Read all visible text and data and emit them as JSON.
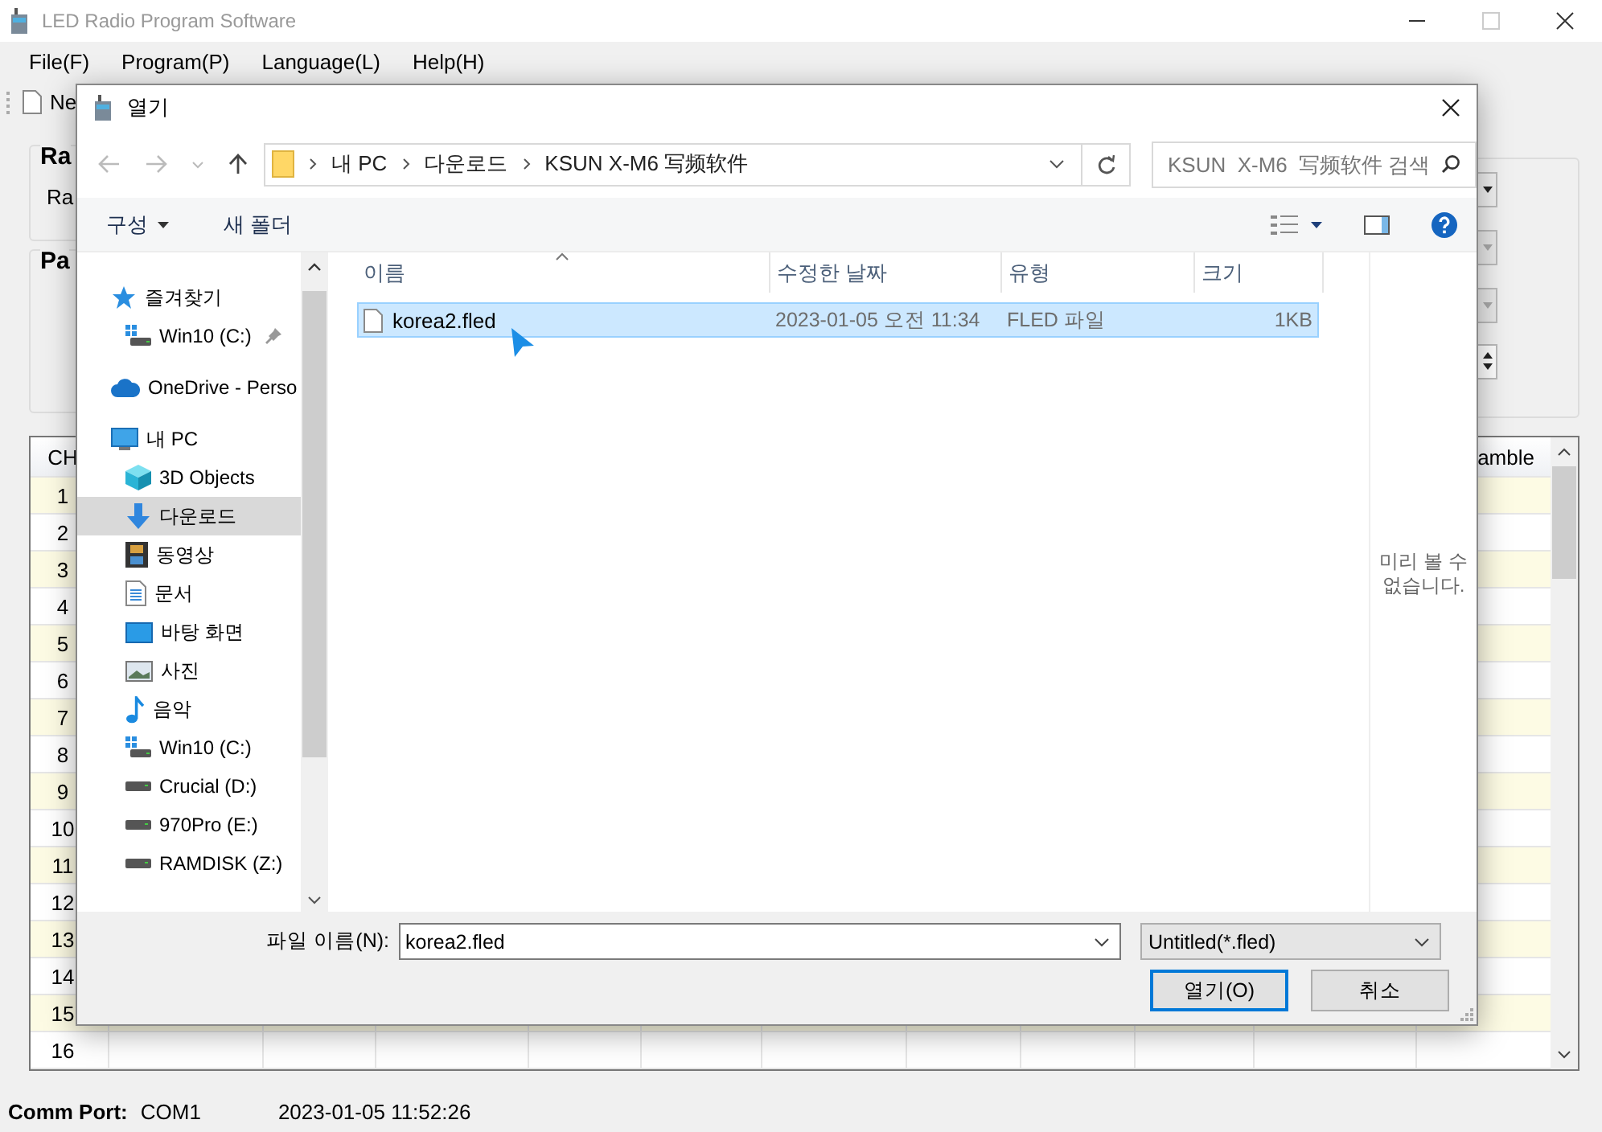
{
  "app": {
    "title": "LED Radio Program Software",
    "menu": [
      "File(F)",
      "Program(P)",
      "Language(L)",
      "Help(H)"
    ],
    "toolbar_label": "Ne",
    "groups": [
      {
        "label": "Ra",
        "field_label": "Ra"
      },
      {
        "label": "Pa"
      }
    ],
    "table": {
      "columns": [
        {
          "label": "CH"
        },
        {
          "label": "amble"
        }
      ],
      "rows": [
        {
          "ch": "1"
        },
        {
          "ch": "2"
        },
        {
          "ch": "3"
        },
        {
          "ch": "4"
        },
        {
          "ch": "5"
        },
        {
          "ch": "6"
        },
        {
          "ch": "7"
        },
        {
          "ch": "8"
        },
        {
          "ch": "9"
        },
        {
          "ch": "10"
        },
        {
          "ch": "11"
        },
        {
          "ch": "12"
        },
        {
          "ch": "13"
        },
        {
          "ch": "14"
        },
        {
          "ch": "15"
        },
        {
          "ch": "16"
        }
      ]
    },
    "status_bar": {
      "port_label": "Comm Port:",
      "port": "COM1",
      "time": "2023-01-05 11:52:26"
    }
  },
  "dialog": {
    "title": "열기",
    "breadcrumbs": [
      "내 PC",
      "다운로드",
      "KSUN  X-M6  写频软件"
    ],
    "search": {
      "placeholder": "KSUN  X-M6  写频软件 검색"
    },
    "toolbar": [
      "구성",
      "새 폴더"
    ],
    "nav": [
      {
        "label": "즐겨찾기",
        "kind": "star",
        "selected": false,
        "children": [
          {
            "label": "Win10 (C:)",
            "kind": "windrive",
            "selected": false,
            "pinned": true
          }
        ]
      },
      {
        "label": "OneDrive - Perso",
        "kind": "cloud",
        "selected": false
      },
      {
        "label": "내 PC",
        "kind": "pc",
        "selected": false,
        "children": [
          {
            "label": "3D Objects",
            "kind": "cube",
            "selected": false
          },
          {
            "label": "다운로드",
            "kind": "download",
            "selected": true
          },
          {
            "label": "동영상",
            "kind": "film",
            "selected": false
          },
          {
            "label": "문서",
            "kind": "document",
            "selected": false
          },
          {
            "label": "바탕 화면",
            "kind": "desktop",
            "selected": false
          },
          {
            "label": "사진",
            "kind": "image",
            "selected": false
          },
          {
            "label": "음악",
            "kind": "music",
            "selected": false
          },
          {
            "label": "Win10 (C:)",
            "kind": "windrive",
            "selected": false
          },
          {
            "label": "Crucial (D:)",
            "kind": "drive",
            "selected": false
          },
          {
            "label": "970Pro (E:)",
            "kind": "drive",
            "selected": false
          },
          {
            "label": "RAMDISK (Z:)",
            "kind": "drive",
            "selected": false
          }
        ]
      }
    ],
    "columns": [
      "이름",
      "수정한 날짜",
      "유형",
      "크기"
    ],
    "files": [
      {
        "name": "korea2.fled",
        "modified": "2023-01-05 오전 11:34",
        "type": "FLED 파일",
        "size": "1KB",
        "selected": true
      }
    ],
    "preview_message": "미리 볼 수 없습니다.",
    "filename_label": "파일 이름(N):",
    "filename": "korea2.fled",
    "filter": "Untitled(*.fled)",
    "buttons": [
      {
        "label": "열기(O)",
        "default": true
      },
      {
        "label": "취소",
        "default": false
      }
    ]
  }
}
